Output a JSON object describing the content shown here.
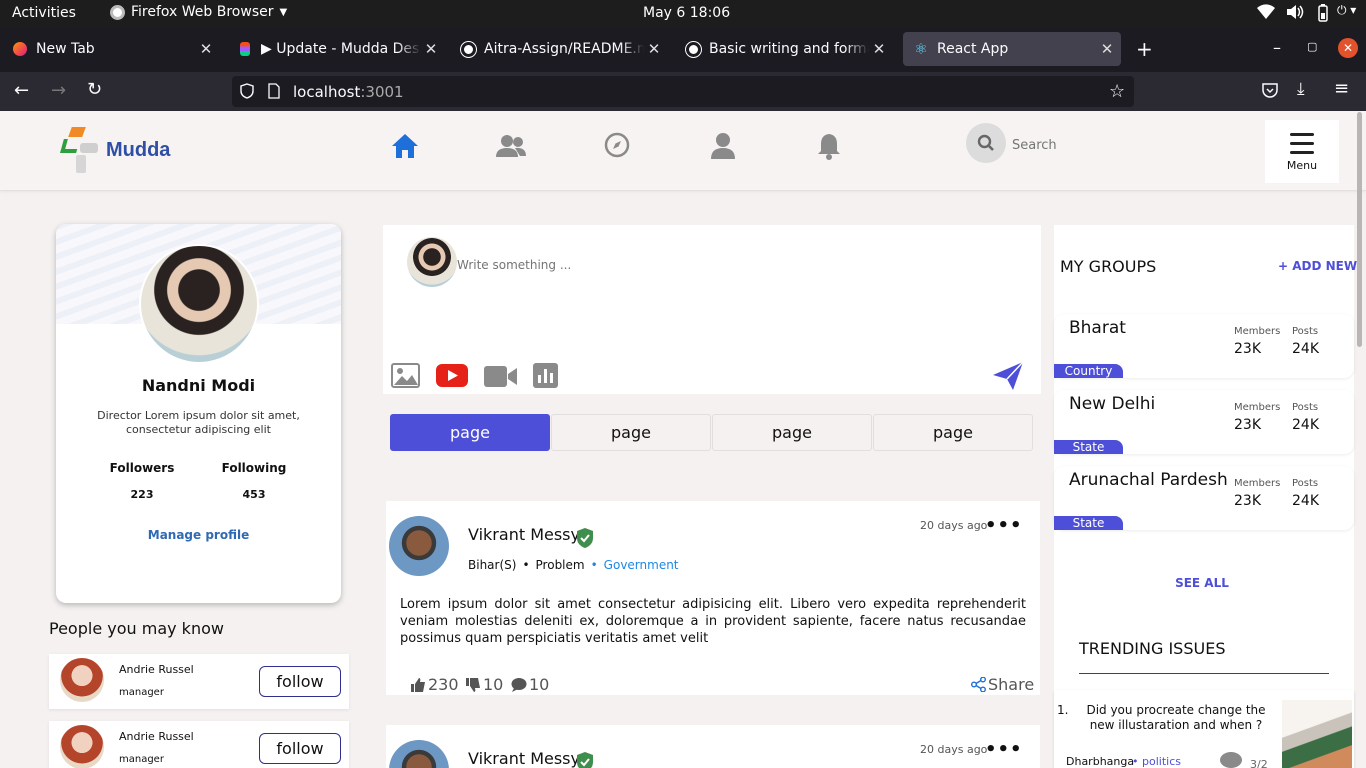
{
  "system": {
    "activities": "Activities",
    "app_name": "Firefox Web Browser",
    "clock": "May 6  18:06"
  },
  "tabs": [
    {
      "label": "New Tab"
    },
    {
      "label": "▶ Update - Mudda Desktop"
    },
    {
      "label": "Aitra-Assign/README.md"
    },
    {
      "label": "Basic writing and formatting"
    },
    {
      "label": "React App"
    }
  ],
  "url": {
    "host": "localhost",
    "port": ":3001"
  },
  "header": {
    "logo_text": "Mudda",
    "search_placeholder": "Search",
    "menu_label": "Menu"
  },
  "profile": {
    "name": "Nandni Modi",
    "bio": "Director Lorem ipsum dolor sit amet, consectetur adipiscing elit",
    "followers_label": "Followers",
    "followers": "223",
    "following_label": "Following",
    "following": "453",
    "manage_label": "Manage profile"
  },
  "people": {
    "title": "People you may know",
    "items": [
      {
        "name": "Andrie Russel",
        "role": "manager",
        "button": "follow"
      },
      {
        "name": "Andrie Russel",
        "role": "manager",
        "button": "follow"
      }
    ]
  },
  "composer": {
    "placeholder": "Write something ..."
  },
  "page_tabs": [
    "page",
    "page",
    "page",
    "page"
  ],
  "posts": [
    {
      "author": "Vikrant Messy",
      "time": "20 days ago",
      "location": "Bihar(S)",
      "category": "Problem",
      "tag": "Government",
      "body": "Lorem ipsum dolor sit amet consectetur adipisicing elit. Libero vero expedita reprehenderit veniam molestias deleniti ex, doloremque a in provident sapiente, facere natus recusandae possimus quam perspiciatis veritatis amet velit",
      "likes": "230",
      "dislikes": "10",
      "comments": "10",
      "share": "Share"
    },
    {
      "author": "Vikrant Messy",
      "time": "20 days ago"
    }
  ],
  "groups": {
    "title": "MY GROUPS",
    "add_new": "+ ADD NEW",
    "members_label": "Members",
    "posts_label": "Posts",
    "items": [
      {
        "name": "Bharat",
        "type": "Country",
        "members": "23K",
        "posts": "24K"
      },
      {
        "name": "New Delhi",
        "type": "State",
        "members": "23K",
        "posts": "24K"
      },
      {
        "name": "Arunachal Pardesh",
        "type": "State",
        "members": "23K",
        "posts": "24K"
      }
    ],
    "see_all": "SEE ALL"
  },
  "trending": {
    "title": "TRENDING ISSUES",
    "items": [
      {
        "index": "1.",
        "question": "Did you procreate change the new illustaration and when ?",
        "location": "Dharbhanga",
        "tag": "politics",
        "count": "3/2"
      }
    ]
  },
  "colors": {
    "accent": "#4e4fd8",
    "link": "#2f6ab3",
    "tag": "#1e88e5",
    "youtube": "#e62117"
  }
}
